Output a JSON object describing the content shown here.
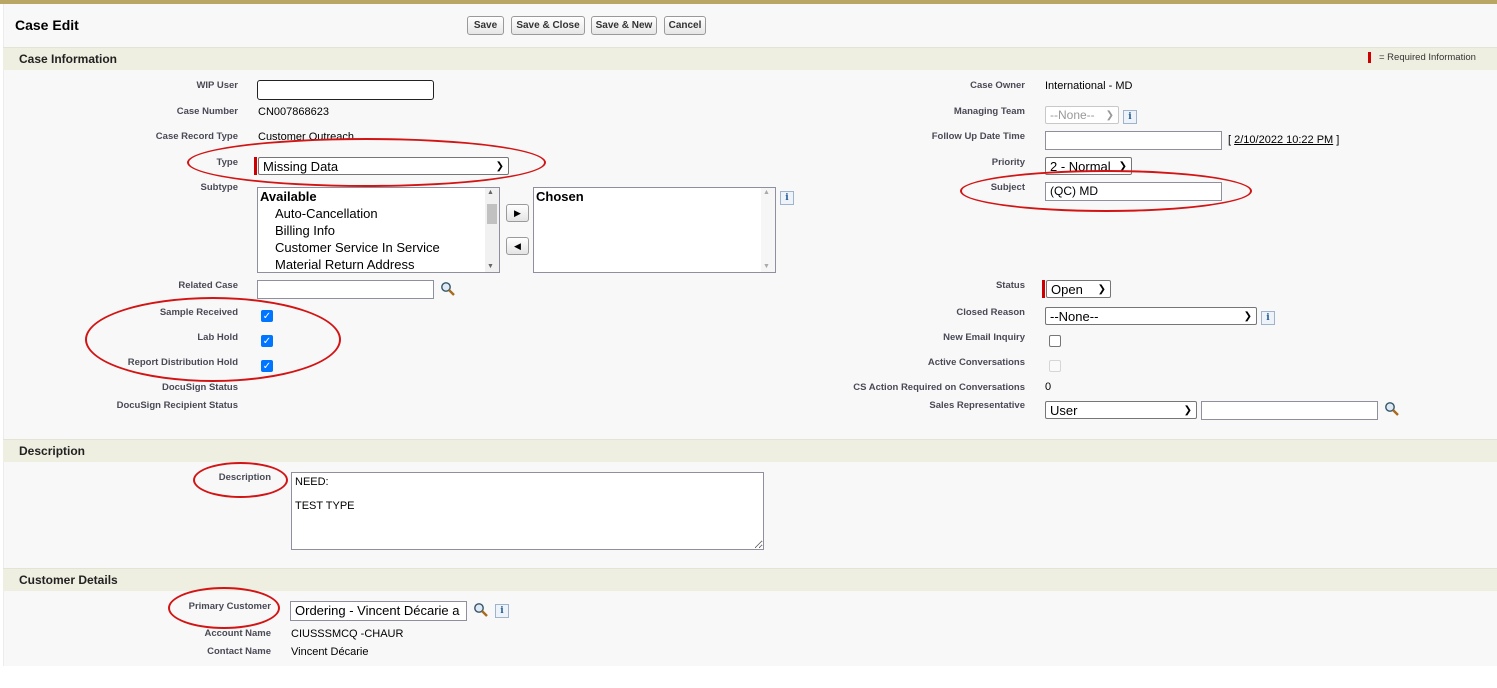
{
  "header": {
    "title": "Case Edit",
    "buttons": {
      "save": "Save",
      "save_close": "Save & Close",
      "save_new": "Save & New",
      "cancel": "Cancel"
    }
  },
  "sections": {
    "case_info": "Case Information",
    "required_note": "= Required Information",
    "description": "Description",
    "customer": "Customer Details"
  },
  "left_fields": {
    "wip_user": {
      "label": "WIP User",
      "value": ""
    },
    "case_number": {
      "label": "Case Number",
      "value": "CN007868623"
    },
    "record_type": {
      "label": "Case Record Type",
      "value": "Customer Outreach"
    },
    "type": {
      "label": "Type",
      "value": "Missing Data"
    },
    "subtype": {
      "label": "Subtype",
      "available_header": "Available",
      "available": [
        "Auto-Cancellation",
        "Billing Info",
        "Customer Service In Service",
        "Material Return Address"
      ],
      "chosen_header": "Chosen"
    },
    "related_case": {
      "label": "Related Case",
      "value": ""
    },
    "sample_received": {
      "label": "Sample Received",
      "checked": true
    },
    "lab_hold": {
      "label": "Lab Hold",
      "checked": true
    },
    "report_distribution_hold": {
      "label": "Report Distribution Hold",
      "checked": true
    },
    "docusign_status": {
      "label": "DocuSign Status"
    },
    "docusign_recipient_status": {
      "label": "DocuSign Recipient Status"
    }
  },
  "right_fields": {
    "case_owner": {
      "label": "Case Owner",
      "value": "International - MD"
    },
    "managing_team": {
      "label": "Managing Team",
      "value": "--None--"
    },
    "follow_up": {
      "label": "Follow Up Date Time",
      "value": "",
      "bracket_open": "[",
      "date_link": "2/10/2022 10:22 PM",
      "bracket_close": "]"
    },
    "priority": {
      "label": "Priority",
      "value": "2 - Normal"
    },
    "subject": {
      "label": "Subject",
      "value": "(QC) MD"
    },
    "status": {
      "label": "Status",
      "value": "Open"
    },
    "closed_reason": {
      "label": "Closed Reason",
      "value": "--None--"
    },
    "new_email_inquiry": {
      "label": "New Email Inquiry",
      "checked": false
    },
    "active_conversations": {
      "label": "Active Conversations",
      "checked": false
    },
    "cs_action": {
      "label": "CS Action Required on Conversations",
      "value": "0"
    },
    "sales_rep": {
      "label": "Sales Representative",
      "type_value": "User",
      "value": ""
    }
  },
  "description": {
    "label": "Description",
    "value": "NEED:\n\nTEST TYPE"
  },
  "customer": {
    "primary_customer": {
      "label": "Primary Customer",
      "value": "Ordering - Vincent Décarie a"
    },
    "account_name": {
      "label": "Account Name",
      "value": "CIUSSSMCQ -CHAUR"
    },
    "contact_name": {
      "label": "Contact Name",
      "value": "Vincent Décarie"
    }
  },
  "colors": {
    "annotation": "#d21414",
    "required": "#cc0000",
    "section_bg": "#efefe1",
    "top_border": "#b8a662"
  }
}
